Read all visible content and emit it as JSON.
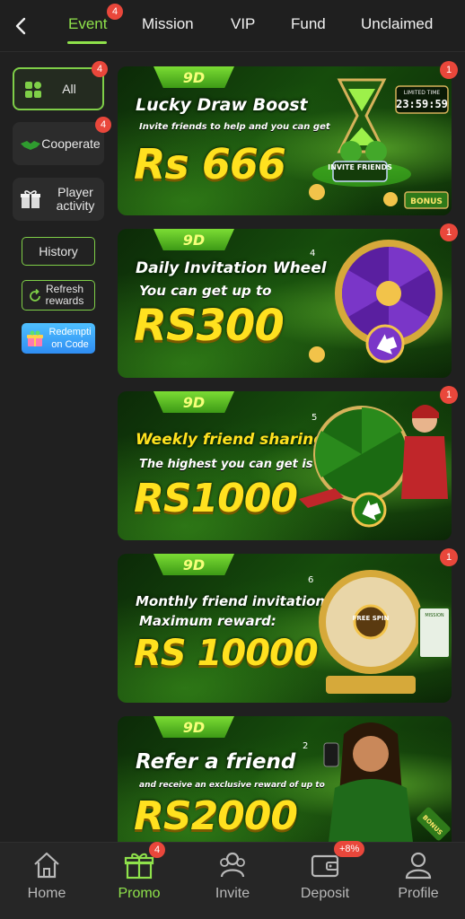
{
  "topnav": {
    "tabs": [
      {
        "label": "Event",
        "badge": "4"
      },
      {
        "label": "Mission"
      },
      {
        "label": "VIP"
      },
      {
        "label": "Fund"
      },
      {
        "label": "Unclaimed"
      }
    ],
    "active_tab": "Event"
  },
  "sidebar": {
    "all": {
      "label": "All",
      "badge": "4"
    },
    "cooperate": {
      "label": "Cooperate",
      "badge": "4"
    },
    "player_activity": {
      "label": "Player activity"
    },
    "history": {
      "label": "History"
    },
    "refresh": {
      "label": "Refresh rewards"
    },
    "redeem": {
      "label": "Redempti on Code"
    }
  },
  "banners": [
    {
      "brand": "9D",
      "title": "Lucky Draw Boost",
      "subtitle": "Invite friends to help and you can get",
      "amount": "Rs 666",
      "badge": "1",
      "extra1": "LIMITED TIME",
      "extra2": "23:59:59",
      "extra3": "INVITE FRIENDS",
      "extra4": "BONUS"
    },
    {
      "brand": "9D",
      "title": "Daily Invitation Wheel",
      "subtitle": "You can get up to",
      "amount": "RS300",
      "badge": "1",
      "num": "4"
    },
    {
      "brand": "9D",
      "title": "Weekly friend sharing",
      "subtitle": "The highest you can get is",
      "amount": "RS1000",
      "badge": "1",
      "num": "5"
    },
    {
      "brand": "9D",
      "title": "Monthly friend invitations",
      "subtitle": "Maximum reward:",
      "amount": "RS 10000",
      "badge": "1",
      "num": "6",
      "extra1": "FREE SPIN",
      "extra2": "MISSION"
    },
    {
      "brand": "9D",
      "title": "Refer a friend",
      "subtitle": "and receive an exclusive reward of up to",
      "amount": "RS2000",
      "num": "2",
      "extra4": "BONUS"
    }
  ],
  "bottomnav": {
    "items": [
      {
        "label": "Home",
        "icon": "home-icon"
      },
      {
        "label": "Promo",
        "icon": "gift-icon",
        "badge": "4"
      },
      {
        "label": "Invite",
        "icon": "invite-icon"
      },
      {
        "label": "Deposit",
        "icon": "wallet-icon",
        "badge": "+8%"
      },
      {
        "label": "Profile",
        "icon": "profile-icon"
      }
    ],
    "active": "Promo"
  },
  "colors": {
    "accent": "#8fe24b",
    "badge": "#e9473b",
    "background": "#202020",
    "amount": "#ffe11f"
  }
}
